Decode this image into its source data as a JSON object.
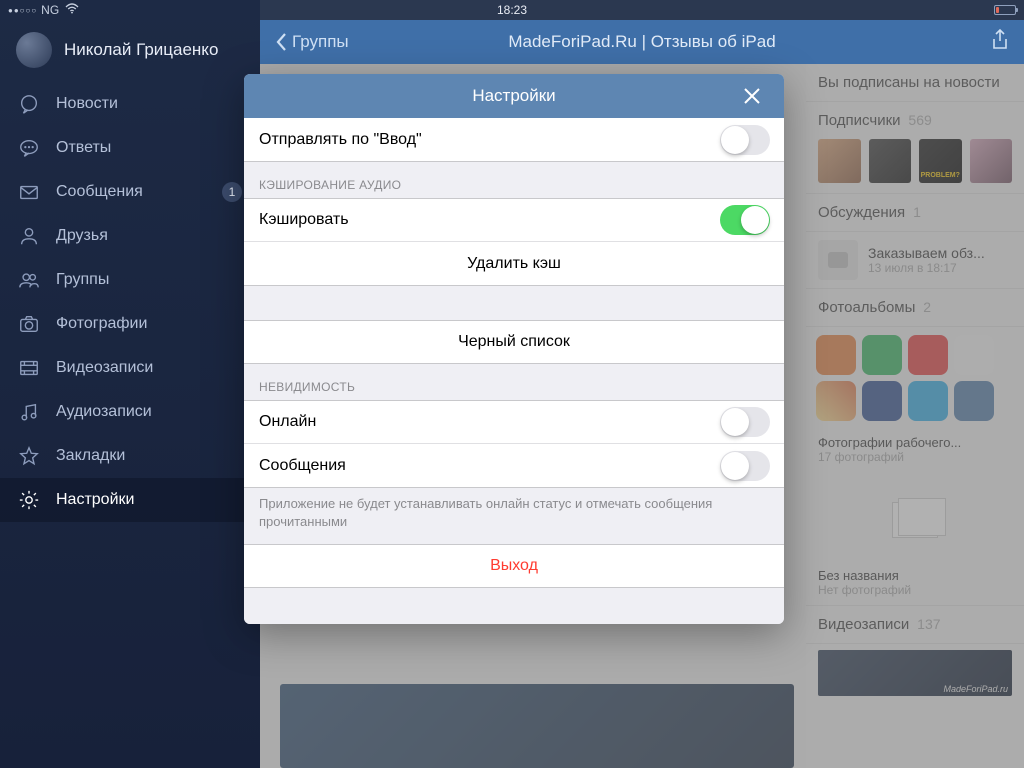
{
  "status": {
    "carrier": "NG",
    "time": "18:23"
  },
  "profile": {
    "name": "Николай Грицаенко"
  },
  "sidebar": {
    "items": [
      {
        "label": "Новости",
        "icon": "bubble"
      },
      {
        "label": "Ответы",
        "icon": "chat"
      },
      {
        "label": "Сообщения",
        "icon": "mail",
        "badge": "1"
      },
      {
        "label": "Друзья",
        "icon": "person"
      },
      {
        "label": "Группы",
        "icon": "people"
      },
      {
        "label": "Фотографии",
        "icon": "photo"
      },
      {
        "label": "Видеозаписи",
        "icon": "video"
      },
      {
        "label": "Аудиозаписи",
        "icon": "audio"
      },
      {
        "label": "Закладки",
        "icon": "star"
      },
      {
        "label": "Настройки",
        "icon": "gear",
        "active": true
      }
    ]
  },
  "header": {
    "back": "Группы",
    "title": "MadeForiPad.Ru | Отзывы об iPad"
  },
  "right": {
    "subscribed": "Вы подписаны на новости",
    "subscribers_label": "Подписчики",
    "subscribers_count": "569",
    "problem_thumb": "PROBLEM?",
    "discussions_label": "Обсуждения",
    "discussions_count": "1",
    "discussion_title": "Заказываем обз...",
    "discussion_time": "13 июля в 18:17",
    "albums_label": "Фотоальбомы",
    "albums_count": "2",
    "album1_title": "Фотографии рабочего...",
    "album1_sub": "17 фотографий",
    "album2_title": "Без названия",
    "album2_sub": "Нет фотографий",
    "videos_label": "Видеозаписи",
    "videos_count": "137",
    "watermark": "MadeForiPad.ru"
  },
  "modal": {
    "title": "Настройки",
    "send_on_enter": "Отправлять по \"Ввод\"",
    "section_cache": "КЭШИРОВАНИЕ АУДИО",
    "cache": "Кэшировать",
    "clear_cache": "Удалить кэш",
    "blacklist": "Черный список",
    "section_invis": "НЕВИДИМОСТЬ",
    "online": "Онлайн",
    "messages": "Сообщения",
    "invis_footer": "Приложение не будет устанавливать онлайн статус и отмечать сообщения прочитанными",
    "logout": "Выход"
  }
}
